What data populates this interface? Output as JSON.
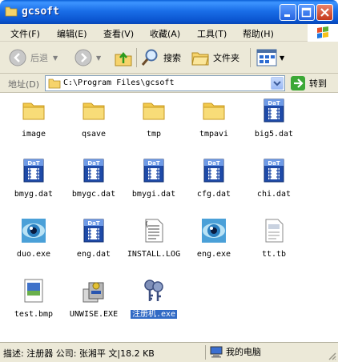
{
  "window": {
    "title": "gcsoft"
  },
  "menu": [
    {
      "label": "文件(F)"
    },
    {
      "label": "编辑(E)"
    },
    {
      "label": "查看(V)"
    },
    {
      "label": "收藏(A)"
    },
    {
      "label": "工具(T)"
    },
    {
      "label": "帮助(H)"
    }
  ],
  "toolbar": {
    "back_label": "后退",
    "search_label": "搜索",
    "folders_label": "文件夹"
  },
  "address": {
    "label": "地址(D)",
    "value": "C:\\Program Files\\gcsoft",
    "go_label": "转到"
  },
  "files": [
    {
      "name": "image",
      "icon": "folder-icon"
    },
    {
      "name": "qsave",
      "icon": "folder-icon"
    },
    {
      "name": "tmp",
      "icon": "folder-icon"
    },
    {
      "name": "tmpavi",
      "icon": "folder-icon"
    },
    {
      "name": "big5.dat",
      "icon": "dat-file-icon"
    },
    {
      "name": "bmyg.dat",
      "icon": "dat-file-icon"
    },
    {
      "name": "bmygc.dat",
      "icon": "dat-file-icon"
    },
    {
      "name": "bmygi.dat",
      "icon": "dat-file-icon"
    },
    {
      "name": "cfg.dat",
      "icon": "dat-file-icon"
    },
    {
      "name": "chi.dat",
      "icon": "dat-file-icon"
    },
    {
      "name": "duo.exe",
      "icon": "eye-app-icon"
    },
    {
      "name": "eng.dat",
      "icon": "dat-file-icon"
    },
    {
      "name": "INSTALL.LOG",
      "icon": "text-file-icon"
    },
    {
      "name": "eng.exe",
      "icon": "eye-app-icon"
    },
    {
      "name": "tt.tb",
      "icon": "doc-file-icon"
    },
    {
      "name": "test.bmp",
      "icon": "bitmap-file-icon"
    },
    {
      "name": "UNWISE.EXE",
      "icon": "installer-icon"
    },
    {
      "name": "注册机.exe",
      "icon": "keygen-icon",
      "selected": true
    }
  ],
  "status": {
    "description": "描述: 注册器 公司: 张湘平 文|18.2 KB",
    "location": "我的电脑"
  },
  "colors": {
    "title_bar": "#0b55d0",
    "chrome": "#ece9d8",
    "selection": "#316ac5"
  }
}
